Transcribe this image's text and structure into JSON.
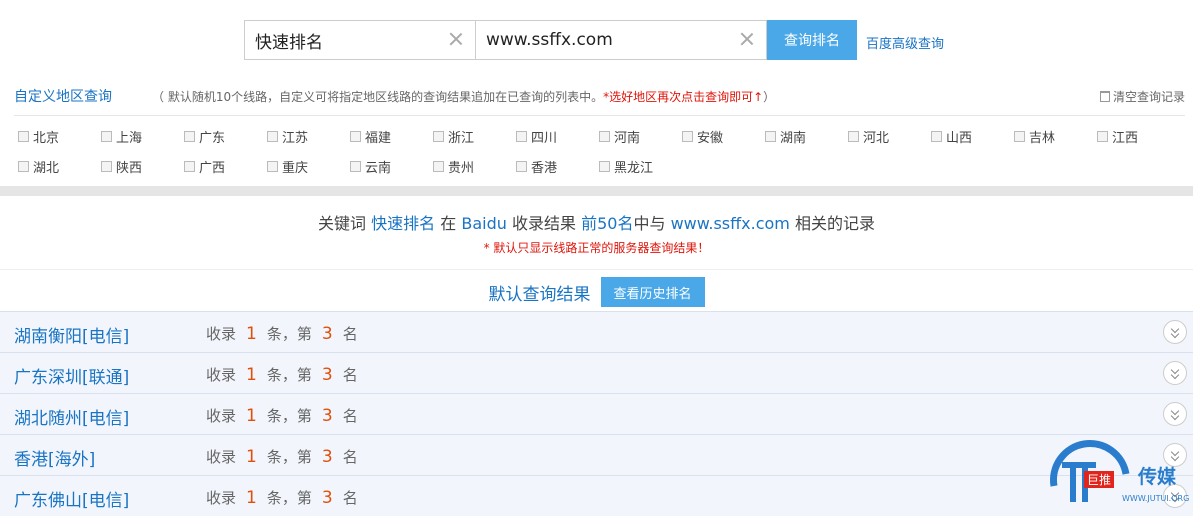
{
  "search": {
    "keyword": "快速排名",
    "site": "www.ssffx.com",
    "query_button": "查询排名",
    "advanced_link": "百度高级查询"
  },
  "region": {
    "title": "自定义地区查询",
    "note_prefix": "（ 默认随机10个线路，自定义可将指定地区线路的查询结果追加在已查询的列表中。",
    "note_red": "*选好地区再次点击查询即可↑",
    "note_suffix": "）",
    "clear_history": "清空查询记录",
    "items": [
      "北京",
      "上海",
      "广东",
      "江苏",
      "福建",
      "浙江",
      "四川",
      "河南",
      "安徽",
      "湖南",
      "河北",
      "山西",
      "吉林",
      "江西",
      "湖北",
      "陕西",
      "广西",
      "重庆",
      "云南",
      "贵州",
      "香港",
      "黑龙江"
    ]
  },
  "summary": {
    "p1": "关键词",
    "keyword": "快速排名",
    "p2": "在",
    "engine": "Baidu",
    "p3": "收录结果",
    "range": "前50名",
    "p4": "中与",
    "site": "www.ssffx.com",
    "p5": "相关的记录",
    "warning": "* 默认只显示线路正常的服务器查询结果！"
  },
  "results": {
    "title": "默认查询结果",
    "history_button": "查看历史排名",
    "rows": [
      {
        "location": "湖南衡阳[电信]",
        "a": "收录",
        "count": "1",
        "b": "条，第",
        "rank": "3",
        "c": "名"
      },
      {
        "location": "广东深圳[联通]",
        "a": "收录",
        "count": "1",
        "b": "条，第",
        "rank": "3",
        "c": "名"
      },
      {
        "location": "湖北随州[电信]",
        "a": "收录",
        "count": "1",
        "b": "条，第",
        "rank": "3",
        "c": "名"
      },
      {
        "location": "香港[海外]",
        "a": "收录",
        "count": "1",
        "b": "条，第",
        "rank": "3",
        "c": "名"
      },
      {
        "location": "广东佛山[电信]",
        "a": "收录",
        "count": "1",
        "b": "条，第",
        "rank": "3",
        "c": "名"
      }
    ]
  },
  "watermark": {
    "small": "巨推",
    "big": "传媒",
    "url": "WWW.JUTUI.ORG"
  }
}
